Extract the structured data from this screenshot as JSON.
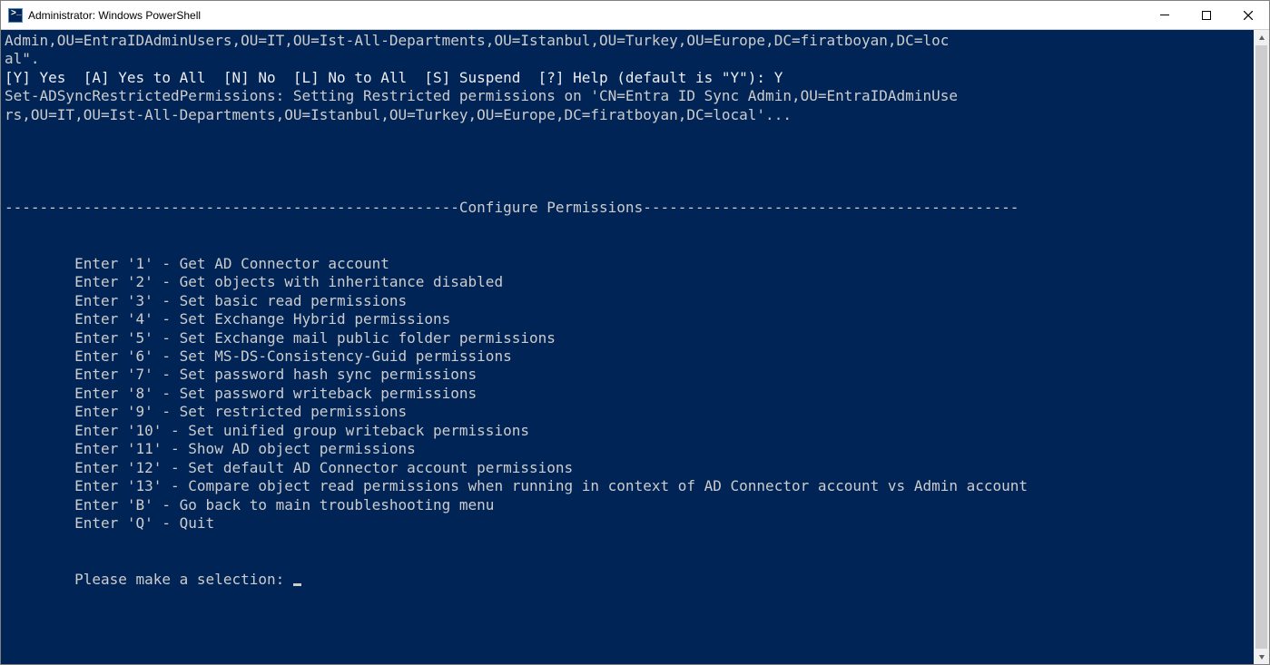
{
  "titlebar": {
    "title": "Administrator: Windows PowerShell"
  },
  "terminal": {
    "prelude_line1": "Admin,OU=EntraIDAdminUsers,OU=IT,OU=Ist-All-Departments,OU=Istanbul,OU=Turkey,OU=Europe,DC=firatboyan,DC=loc",
    "prelude_line2": "al\".",
    "prompt_options": "[Y] Yes  [A] Yes to All  [N] No  [L] No to All  [S] Suspend  [?] Help (default is \"Y\"): Y",
    "status_line1": "Set-ADSyncRestrictedPermissions: Setting Restricted permissions on 'CN=Entra ID Sync Admin,OU=EntraIDAdminUse",
    "status_line2": "rs,OU=IT,OU=Ist-All-Departments,OU=Istanbul,OU=Turkey,OU=Europe,DC=firatboyan,DC=local'...",
    "divider": "----------------------------------------------------Configure Permissions-------------------------------------------",
    "menu_items": [
      "        Enter '1' - Get AD Connector account",
      "        Enter '2' - Get objects with inheritance disabled",
      "        Enter '3' - Set basic read permissions",
      "        Enter '4' - Set Exchange Hybrid permissions",
      "        Enter '5' - Set Exchange mail public folder permissions",
      "        Enter '6' - Set MS-DS-Consistency-Guid permissions",
      "        Enter '7' - Set password hash sync permissions",
      "        Enter '8' - Set password writeback permissions",
      "        Enter '9' - Set restricted permissions",
      "        Enter '10' - Set unified group writeback permissions",
      "        Enter '11' - Show AD object permissions",
      "        Enter '12' - Set default AD Connector account permissions",
      "        Enter '13' - Compare object read permissions when running in context of AD Connector account vs Admin account",
      "        Enter 'B' - Go back to main troubleshooting menu",
      "        Enter 'Q' - Quit"
    ],
    "prompt_selection": "        Please make a selection: "
  }
}
